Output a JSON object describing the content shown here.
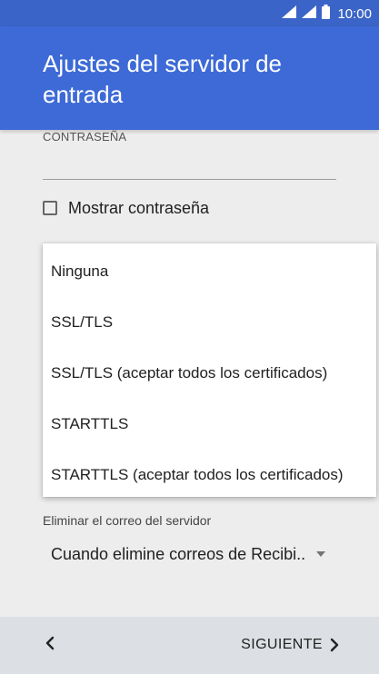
{
  "status_bar": {
    "time": "10:00",
    "icons": [
      "wifi-icon",
      "signal-icon",
      "battery-icon"
    ]
  },
  "app_bar": {
    "title": "Ajustes del servidor de entrada"
  },
  "form": {
    "password_label": "CONTRASEÑA",
    "password_value": "",
    "show_password_label": "Mostrar contraseña",
    "show_password_checked": false
  },
  "security_dropdown": {
    "options": [
      "Ninguna",
      "SSL/TLS",
      "SSL/TLS (aceptar todos los certificados)",
      "STARTTLS",
      "STARTTLS (aceptar todos los certificados)"
    ]
  },
  "delete_mail": {
    "label": "Eliminar el correo del servidor",
    "value": "Cuando elimine correos de Recibi.."
  },
  "bottom_bar": {
    "back_icon": "chevron-left-icon",
    "next_label": "SIGUIENTE",
    "next_icon": "chevron-right-icon"
  },
  "colors": {
    "app_bar": "#3d6ad6",
    "status_bar": "#3a64c7",
    "background": "#ededed",
    "bottom_bar": "#dcdfe3"
  }
}
